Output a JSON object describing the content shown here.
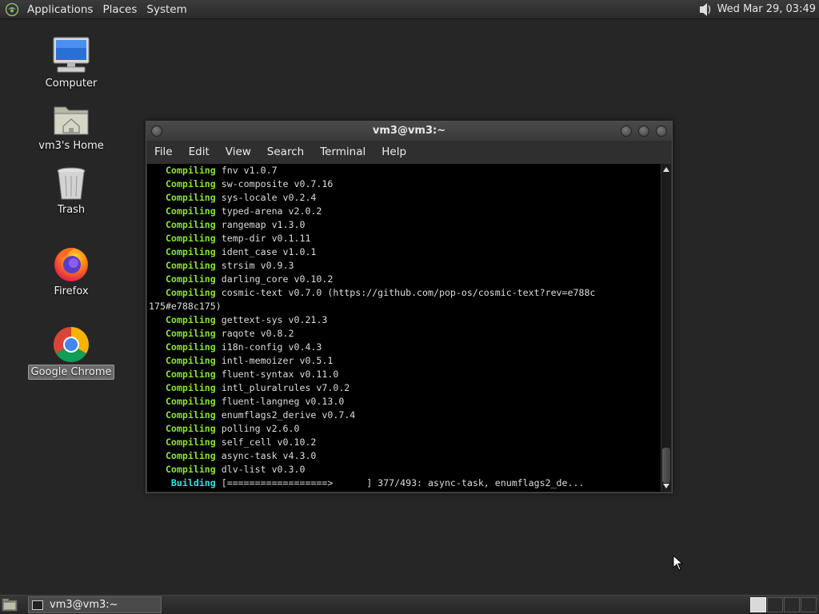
{
  "top_panel": {
    "menus": [
      "Applications",
      "Places",
      "System"
    ],
    "clock": "Wed Mar 29, 03:49",
    "icons": {
      "menu_logo": "distro-logo-icon",
      "volume": "volume-icon"
    }
  },
  "desktop_icons": [
    {
      "label": "Computer",
      "icon": "computer-icon"
    },
    {
      "label": "vm3's Home",
      "icon": "home-folder-icon"
    },
    {
      "label": "Trash",
      "icon": "trash-icon"
    },
    {
      "label": "Firefox",
      "icon": "firefox-icon"
    },
    {
      "label": "Google Chrome",
      "icon": "chrome-icon",
      "selected": true
    }
  ],
  "terminal": {
    "title": "vm3@vm3:~",
    "menu": [
      "File",
      "Edit",
      "View",
      "Search",
      "Terminal",
      "Help"
    ],
    "lines": [
      {
        "kw": "Compiling",
        "text": " fnv v1.0.7"
      },
      {
        "kw": "Compiling",
        "text": " sw-composite v0.7.16"
      },
      {
        "kw": "Compiling",
        "text": " sys-locale v0.2.4"
      },
      {
        "kw": "Compiling",
        "text": " typed-arena v2.0.2"
      },
      {
        "kw": "Compiling",
        "text": " rangemap v1.3.0"
      },
      {
        "kw": "Compiling",
        "text": " temp-dir v0.1.11"
      },
      {
        "kw": "Compiling",
        "text": " ident_case v1.0.1"
      },
      {
        "kw": "Compiling",
        "text": " strsim v0.9.3"
      },
      {
        "kw": "Compiling",
        "text": " darling_core v0.10.2"
      },
      {
        "kw": "Compiling",
        "text": " cosmic-text v0.7.0 (https://github.com/pop-os/cosmic-text?rev=e788c"
      },
      {
        "kw": "",
        "text": "175#e788c175)"
      },
      {
        "kw": "Compiling",
        "text": " gettext-sys v0.21.3"
      },
      {
        "kw": "Compiling",
        "text": " raqote v0.8.2"
      },
      {
        "kw": "Compiling",
        "text": " i18n-config v0.4.3"
      },
      {
        "kw": "Compiling",
        "text": " intl-memoizer v0.5.1"
      },
      {
        "kw": "Compiling",
        "text": " fluent-syntax v0.11.0"
      },
      {
        "kw": "Compiling",
        "text": " intl_pluralrules v7.0.2"
      },
      {
        "kw": "Compiling",
        "text": " fluent-langneg v0.13.0"
      },
      {
        "kw": "Compiling",
        "text": " enumflags2_derive v0.7.4"
      },
      {
        "kw": "Compiling",
        "text": " polling v2.6.0"
      },
      {
        "kw": "Compiling",
        "text": " self_cell v0.10.2"
      },
      {
        "kw": "Compiling",
        "text": " async-task v4.3.0"
      },
      {
        "kw": "Compiling",
        "text": " dlv-list v0.3.0"
      }
    ],
    "building": {
      "kw": "Building",
      "text": " [==================>      ] 377/493: async-task, enumflags2_de..."
    },
    "colors": {
      "compiling": "#8ae234",
      "building": "#34e2e2",
      "text": "#dcdcdc",
      "background": "#000000"
    }
  },
  "bottom_panel": {
    "show_desktop_icon": "show-desktop-icon",
    "task": {
      "label": "vm3@vm3:~",
      "icon": "terminal-icon"
    },
    "workspaces": 4,
    "active_workspace": 1
  }
}
